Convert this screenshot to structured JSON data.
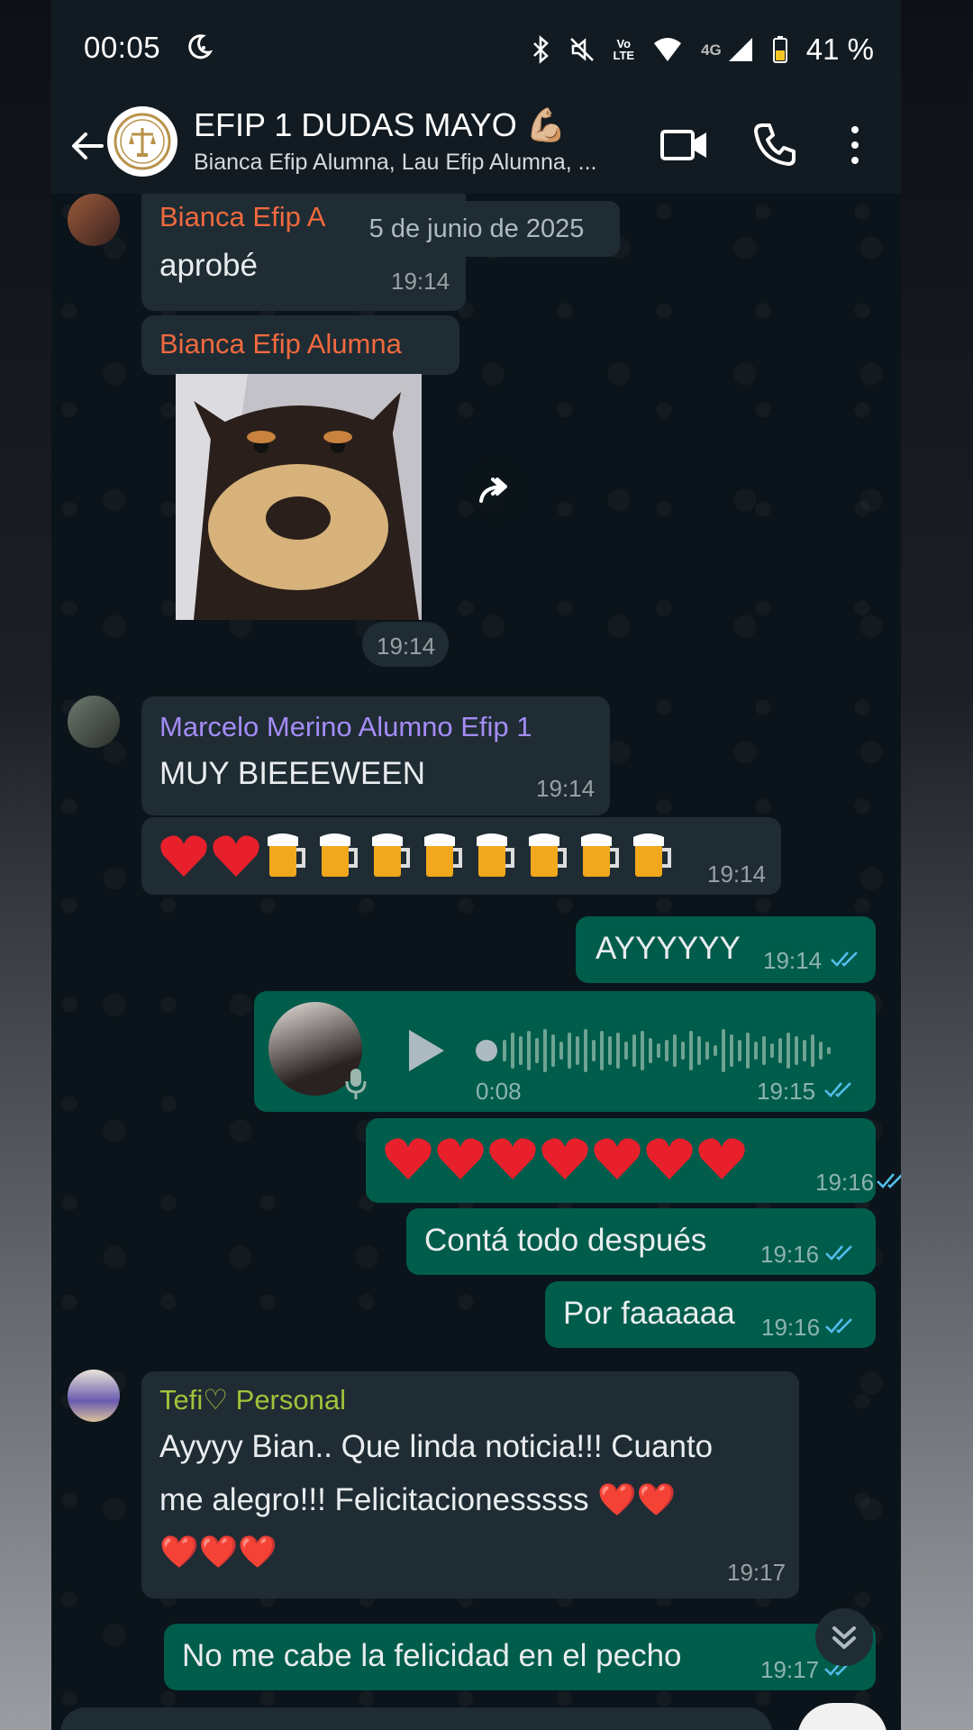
{
  "status_bar": {
    "time": "00:05",
    "volte": "Vo",
    "lte": "LTE",
    "net_4g": "4G",
    "battery_pct": "41 %"
  },
  "header": {
    "title": "EFIP 1 DUDAS MAYO 💪🏼",
    "subtitle": "Bianca Efip Alumna, Lau Efip Alumna, ..."
  },
  "chat": {
    "date_chip": "5 de junio de 2025",
    "messages": [
      {
        "sender": "Bianca Efip A",
        "text": "aprobé",
        "time": "19:14"
      },
      {
        "sender": "Bianca Efip Alumna",
        "type": "image",
        "image_icon": "dog-sticker",
        "time": "19:14"
      },
      {
        "sender": "Marcelo Merino Alumno Efip 1",
        "text": "MUY BIEEEWEEN",
        "time": "19:14"
      },
      {
        "text": "❤️❤️🍺🍺🍺🍺🍺🍺🍺🍺",
        "time": "19:14"
      },
      {
        "outgoing": true,
        "text": "AYYYYYY",
        "time": "19:14"
      },
      {
        "outgoing": true,
        "type": "voice",
        "duration": "0:08",
        "time": "19:15"
      },
      {
        "outgoing": true,
        "text": "❤️❤️❤️❤️❤️❤️❤️",
        "time": "19:16"
      },
      {
        "outgoing": true,
        "text": "Contá todo después",
        "time": "19:16"
      },
      {
        "outgoing": true,
        "text": "Por faaaaaa",
        "time": "19:16"
      },
      {
        "sender": "Tefi♡ Personal",
        "text_line1": "Ayyyy Bian.. Que linda noticia!!! Cuanto",
        "text_line2": "me alegro!!! Felicitacionesssss ❤️❤️",
        "text_line3": "❤️❤️❤️",
        "time": "19:17"
      },
      {
        "outgoing": true,
        "text": "No me cabe la felicidad en el pecho",
        "time": "19:17"
      }
    ]
  },
  "colors": {
    "bianca_name": "#f0693e",
    "marcelo_name": "#a48cf5",
    "tefi_name": "#a3c13a",
    "outgoing_bubble": "#005c4b",
    "incoming_bubble": "#1f2c34",
    "read_ticks": "#53bdeb"
  }
}
